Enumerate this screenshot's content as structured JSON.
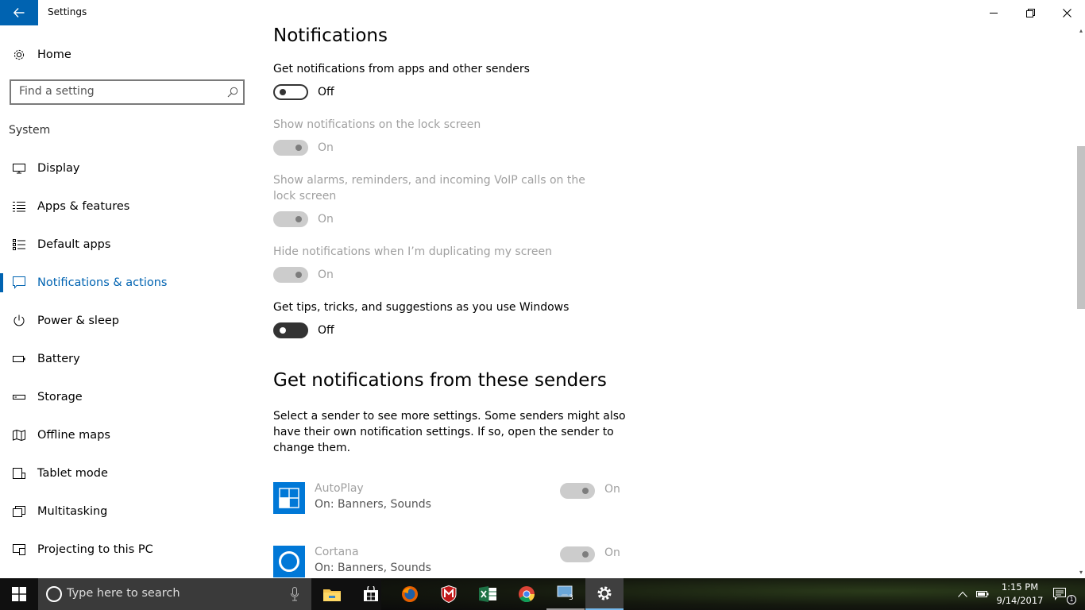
{
  "window": {
    "title": "Settings"
  },
  "sidebar": {
    "home_label": "Home",
    "search": {
      "placeholder": "Find a setting"
    },
    "section_heading": "System",
    "items": [
      {
        "label": "Display",
        "icon": "monitor-icon"
      },
      {
        "label": "Apps & features",
        "icon": "list-icon"
      },
      {
        "label": "Default apps",
        "icon": "default-apps-icon"
      },
      {
        "label": "Notifications & actions",
        "icon": "speech-bubble-icon",
        "selected": true
      },
      {
        "label": "Power & sleep",
        "icon": "power-icon"
      },
      {
        "label": "Battery",
        "icon": "battery-icon"
      },
      {
        "label": "Storage",
        "icon": "storage-icon"
      },
      {
        "label": "Offline maps",
        "icon": "map-icon"
      },
      {
        "label": "Tablet mode",
        "icon": "tablet-icon"
      },
      {
        "label": "Multitasking",
        "icon": "multitasking-icon"
      },
      {
        "label": "Projecting to this PC",
        "icon": "projecting-icon"
      }
    ]
  },
  "main": {
    "heading": "Notifications",
    "settings": [
      {
        "label": "Get notifications from apps and other senders",
        "state": "Off",
        "enabled": true
      },
      {
        "label": "Show notifications on the lock screen",
        "state": "On",
        "enabled": false
      },
      {
        "label": "Show alarms, reminders, and incoming VoIP calls on the lock screen",
        "state": "On",
        "enabled": false
      },
      {
        "label": "Hide notifications when I’m duplicating my screen",
        "state": "On",
        "enabled": false
      },
      {
        "label": "Get tips, tricks, and suggestions as you use Windows",
        "state": "Off",
        "enabled": true
      }
    ],
    "senders_heading": "Get notifications from these senders",
    "senders_description": "Select a sender to see more settings. Some senders might also have their own notification settings. If so, open the sender to change them.",
    "senders": [
      {
        "name": "AutoPlay",
        "detail": "On: Banners, Sounds",
        "state": "On",
        "icon": "autoplay-icon"
      },
      {
        "name": "Cortana",
        "detail": "On: Banners, Sounds",
        "state": "On",
        "icon": "cortana-icon"
      }
    ]
  },
  "taskbar": {
    "search_placeholder": "Type here to search",
    "apps": [
      "file-explorer-icon",
      "store-icon",
      "firefox-icon",
      "mcafee-icon",
      "excel-icon",
      "chrome-icon",
      "rdp-icon",
      "settings-icon"
    ],
    "rdp_badge": "3",
    "clock_time": "1:15 PM",
    "clock_date": "9/14/2017",
    "notification_count": "1"
  },
  "colors": {
    "accent": "#0063b1",
    "tile": "#0078d7",
    "disabled_text": "#a0a0a0"
  }
}
